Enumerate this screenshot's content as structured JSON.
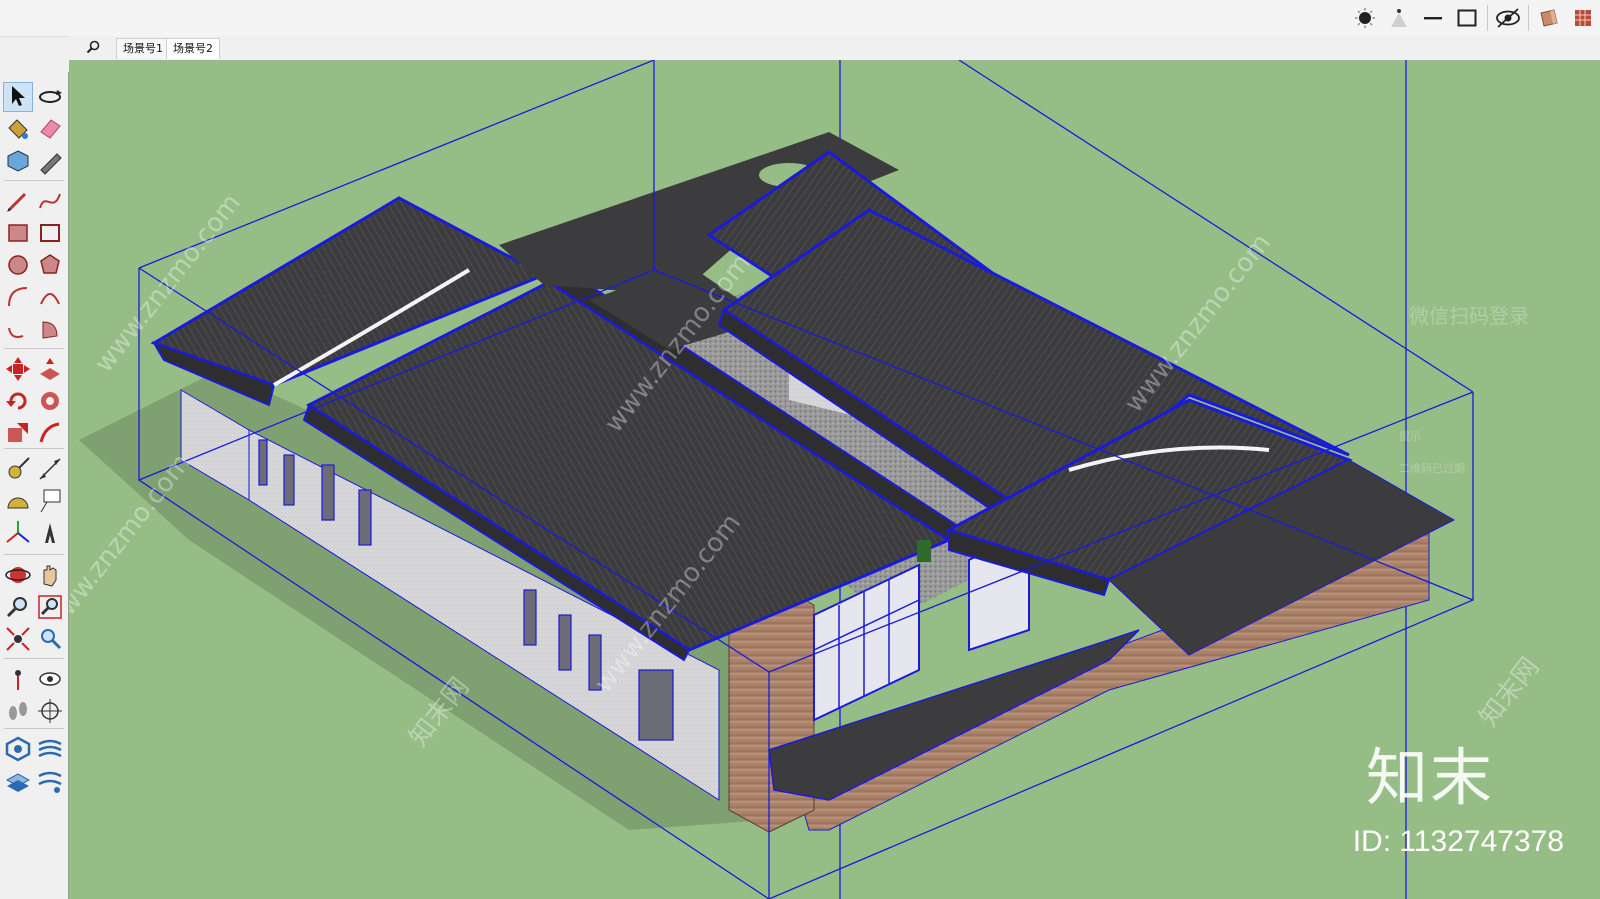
{
  "tabs": [
    {
      "label": "场景号1"
    },
    {
      "label": "场景号2"
    }
  ],
  "toolbar_right": {
    "icons": [
      "shadow-toggle-icon",
      "fog-icon",
      "hidden-line-icon",
      "section-box-icon",
      "hide-icon",
      "paint-icon",
      "material-icon"
    ]
  },
  "tools": [
    "select-icon",
    "orbit-icon",
    "paint-bucket-icon",
    "eraser-icon",
    "component-icon",
    "tape-icon",
    "pencil-icon",
    "freehand-icon",
    "rectangle-icon",
    "rotated-rectangle-icon",
    "circle-icon",
    "polygon-icon",
    "arc-icon",
    "two-point-arc-icon",
    "three-point-arc-icon",
    "pie-icon",
    "move-icon",
    "push-pull-icon",
    "rotate-icon",
    "follow-me-icon",
    "scale-icon",
    "offset-icon",
    "tape-measure-icon",
    "dimension-icon",
    "protractor-icon",
    "text-icon",
    "axes-icon",
    "3d-text-icon",
    "orbit-icon-2",
    "pan-icon",
    "zoom-icon",
    "zoom-window-icon",
    "zoom-extents-icon",
    "previous-view-icon",
    "position-camera-icon",
    "look-around-icon",
    "walk-icon",
    "section-plane-icon",
    "sandbox-icon",
    "sandbox-contour-icon",
    "sandbox-scratch-icon",
    "sandbox-smoove-icon"
  ],
  "watermarks": {
    "site": "www.znzmo.com",
    "site_cn": "知末网",
    "brand": "知末",
    "id": "ID: 1132747378"
  },
  "ghost_panel": {
    "title": "微信扫码登录",
    "tip": "提示",
    "msg": "二维码已过期"
  },
  "colors": {
    "viewport_bg": "#97bd87",
    "roof": "#3a3a3a",
    "edge_blue": "#1a1adb",
    "wall": "#d6d6d8",
    "wood": "#a07b62"
  }
}
